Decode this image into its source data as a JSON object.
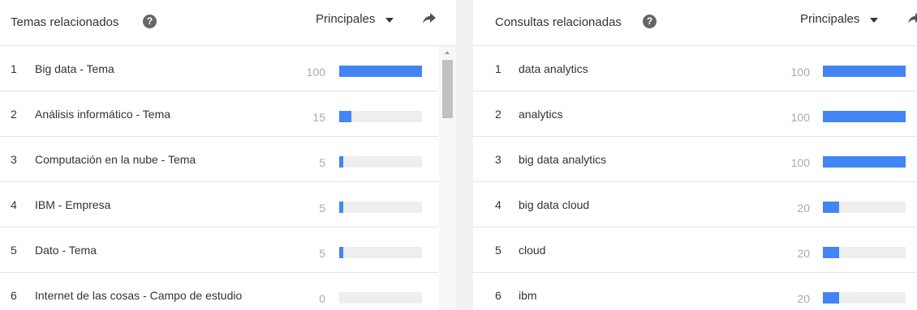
{
  "left_panel": {
    "title": "Temas relacionados",
    "help_symbol": "?",
    "sort_label": "Principales",
    "rows": [
      {
        "rank": "1",
        "label": "Big data - Tema",
        "value": "100",
        "level": 1.0
      },
      {
        "rank": "2",
        "label": "Análisis informático - Tema",
        "value": "15",
        "level": 0.15
      },
      {
        "rank": "3",
        "label": "Computación en la nube - Tema",
        "value": "5",
        "level": 0.05
      },
      {
        "rank": "4",
        "label": "IBM - Empresa",
        "value": "5",
        "level": 0.05
      },
      {
        "rank": "5",
        "label": "Dato - Tema",
        "value": "5",
        "level": 0.05
      },
      {
        "rank": "6",
        "label": "Internet de las cosas - Campo de estudio",
        "value": "0",
        "level": 0.0
      }
    ]
  },
  "right_panel": {
    "title": "Consultas relacionadas",
    "help_symbol": "?",
    "sort_label": "Principales",
    "rows": [
      {
        "rank": "1",
        "label": "data analytics",
        "value": "100",
        "level": 1.0
      },
      {
        "rank": "2",
        "label": "analytics",
        "value": "100",
        "level": 1.0
      },
      {
        "rank": "3",
        "label": "big data analytics",
        "value": "100",
        "level": 1.0
      },
      {
        "rank": "4",
        "label": "big data cloud",
        "value": "20",
        "level": 0.2
      },
      {
        "rank": "5",
        "label": "cloud",
        "value": "20",
        "level": 0.2
      },
      {
        "rank": "6",
        "label": "ibm",
        "value": "20",
        "level": 0.2
      }
    ]
  },
  "colors": {
    "bar": "#4285f4",
    "track": "#eeeeee",
    "page_bg": "#f1f1f1"
  },
  "icons": {
    "help": "help-icon",
    "dropdown": "dropdown-triangle-icon",
    "share": "share-arrow-icon"
  }
}
